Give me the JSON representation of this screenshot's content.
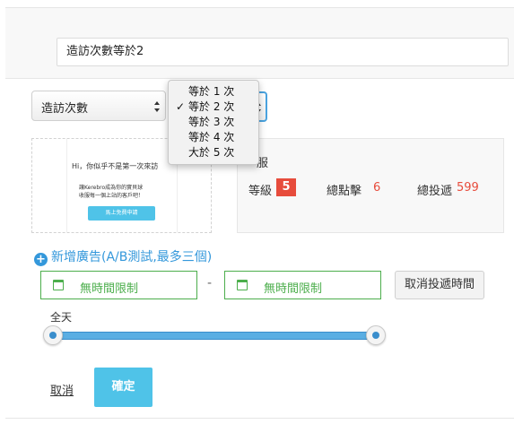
{
  "campaign_name": {
    "value": "造訪次數等於2"
  },
  "condition": {
    "type_select": "造訪次數",
    "options": [
      "等於 1 次",
      "等於 2 次",
      "等於 3 次",
      "等於 4 次",
      "大於 5 次"
    ],
    "selected_option": "等於 2 次",
    "check_mark": "✓"
  },
  "preview": {
    "greeting": "Hi，你似乎不是第一次來訪",
    "line1": "讓Kerebro成為你的實貝球",
    "line2": "收服每一個上站的客戶吧！",
    "cta": "馬上免費申請"
  },
  "stats": {
    "service_fragment": "服",
    "level_label": "等級",
    "level_value": "5",
    "clicks_label": "總點擊",
    "clicks_value": "6",
    "deliveries_label": "總投遞",
    "deliveries_value": "599"
  },
  "add_ad": {
    "plus": "+",
    "label": "新增廣告(A/B測試,最多三個)"
  },
  "schedule": {
    "start": "無時間限制",
    "separator": "-",
    "end": "無時間限制",
    "cancel_label": "取消投遞時間"
  },
  "time_slider": {
    "label": "全天",
    "range_start": 0,
    "range_end": 1
  },
  "actions": {
    "cancel": "取消",
    "confirm": "確定"
  },
  "colors": {
    "accent_blue": "#3498db",
    "green": "#4cae4c",
    "red": "#e74c3c",
    "cyan_button": "#4fc3e8"
  }
}
